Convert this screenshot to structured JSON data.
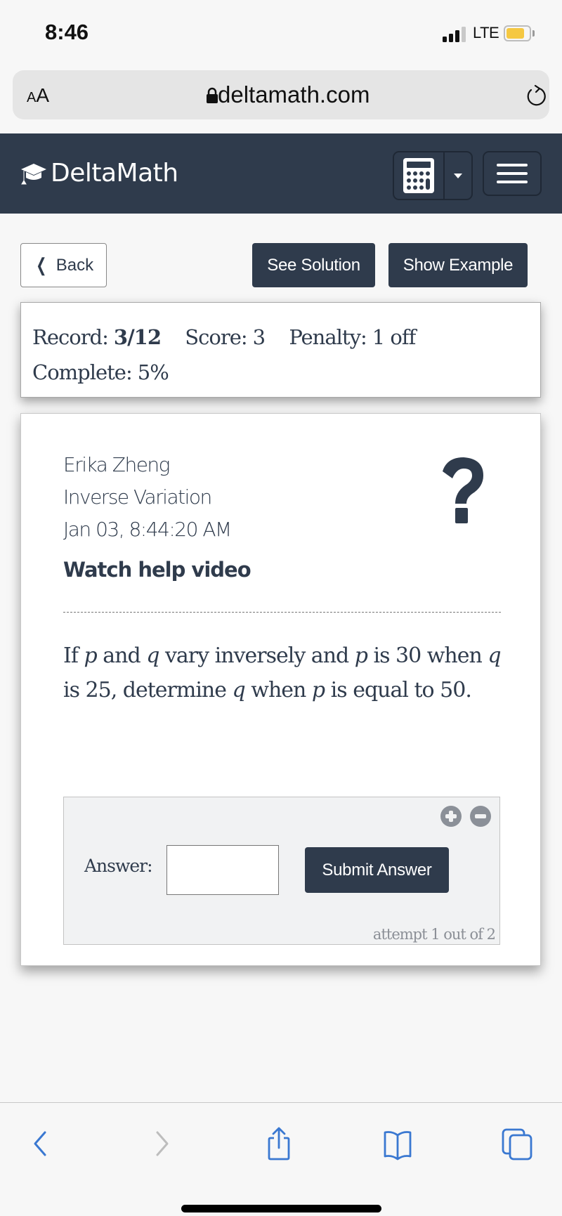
{
  "status_bar": {
    "time": "8:46",
    "network": "LTE",
    "battery_level": 0.8,
    "signal_bars_active": 3,
    "signal_bars_total": 4
  },
  "browser": {
    "text_size_label": "AA",
    "url": "deltamath.com"
  },
  "header": {
    "logo_text": "DeltaMath",
    "icons": [
      "graduation-cap-icon",
      "calculator-icon",
      "caret-down-icon",
      "hamburger-menu-icon"
    ],
    "bg_color": "#2f3b4c"
  },
  "actions": {
    "back_label": "Back",
    "see_solution_label": "See Solution",
    "show_example_label": "Show Example"
  },
  "record": {
    "record_label": "Record:",
    "record_value": "3/12",
    "score_label": "Score:",
    "score_value": "3",
    "penalty_label": "Penalty:",
    "penalty_value": "1 off",
    "complete_label": "Complete:",
    "complete_value": "5%"
  },
  "problem": {
    "student_name": "Erika Zheng",
    "topic": "Inverse Variation",
    "timestamp": "Jan 03, 8:44:20 AM",
    "help_video_label": "Watch help video",
    "question": {
      "parts": [
        {
          "text": "If ",
          "italic": false
        },
        {
          "text": "p",
          "italic": true
        },
        {
          "text": " and ",
          "italic": false
        },
        {
          "text": "q",
          "italic": true
        },
        {
          "text": " vary inversely and ",
          "italic": false
        },
        {
          "text": "p",
          "italic": true
        },
        {
          "text": " is 30 when ",
          "italic": false
        },
        {
          "text": "q",
          "italic": true
        },
        {
          "text": " is 25, determine ",
          "italic": false
        },
        {
          "text": "q",
          "italic": true
        },
        {
          "text": " when ",
          "italic": false
        },
        {
          "text": "p",
          "italic": true
        },
        {
          "text": " is equal to 50.",
          "italic": false
        }
      ]
    }
  },
  "answer": {
    "label": "Answer:",
    "value": "",
    "submit_label": "Submit Answer",
    "attempt_text": "attempt 1 out of 2"
  },
  "colors": {
    "primary": "#2f3b4c",
    "page_bg": "#f7f7f7",
    "ios_blue": "#3a78d1",
    "disabled_gray": "#bdbdbd"
  }
}
